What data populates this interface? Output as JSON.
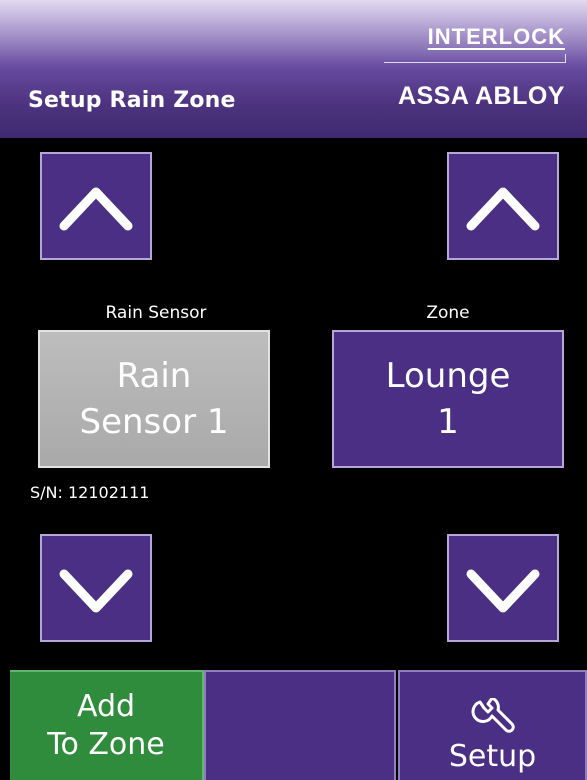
{
  "header": {
    "title": "Setup Rain Zone",
    "brand_top": "INTERLOCK",
    "brand_bottom": "ASSA ABLOY"
  },
  "sensor": {
    "label": "Rain Sensor",
    "value_line1": "Rain",
    "value_line2": "Sensor 1",
    "serial": "S/N: 12102111"
  },
  "zone": {
    "label": "Zone",
    "value_line1": "Lounge",
    "value_line2": "1"
  },
  "bottom_bar": {
    "add_line1": "Add",
    "add_line2": "To Zone",
    "setup_label": "Setup"
  },
  "icons": {
    "up": "chevron-up-icon",
    "down": "chevron-down-icon",
    "setup": "wrench-icon"
  },
  "colors": {
    "purple": "#4a2f84",
    "green": "#2f8c3d",
    "grey": "#b3b3b3",
    "background": "#000000"
  }
}
